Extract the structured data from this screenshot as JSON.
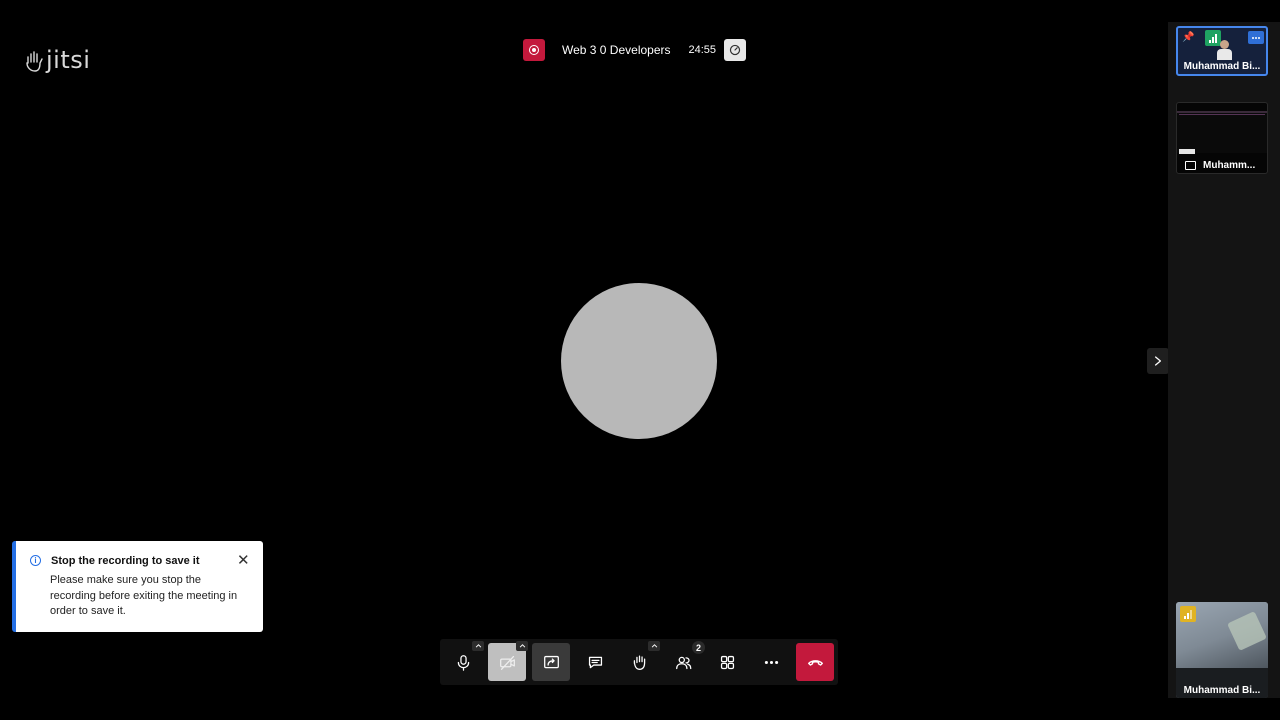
{
  "app": {
    "logo_text": "jitsi"
  },
  "header": {
    "meeting_title": "Web 3 0 Developers",
    "timer": "24:55",
    "recording_icon": "record-icon",
    "quality_icon": "gauge-icon"
  },
  "filmstrip": {
    "tiles": [
      {
        "name": "Muhammad Bi...",
        "connection": "good",
        "pinned": true,
        "active": true
      },
      {
        "name": "Muhamm...",
        "type": "screen-share"
      },
      {
        "name": "Muhammad Bi...",
        "connection": "fair"
      }
    ]
  },
  "notification": {
    "title": "Stop the recording to save it",
    "body": "Please make sure you stop the recording before exiting the meeting in order to save it.",
    "icon": "info-icon"
  },
  "toolbar": {
    "participants_count": "2",
    "buttons": [
      "microphone",
      "camera-off",
      "share-screen",
      "chat",
      "raise-hand",
      "participants",
      "tile-view",
      "more-actions",
      "leave-call"
    ]
  },
  "colors": {
    "recording": "#c3193c",
    "accent": "#246fe5",
    "hangup": "#c3193c",
    "signal_good": "#1fa362",
    "signal_fair": "#e0b323"
  }
}
